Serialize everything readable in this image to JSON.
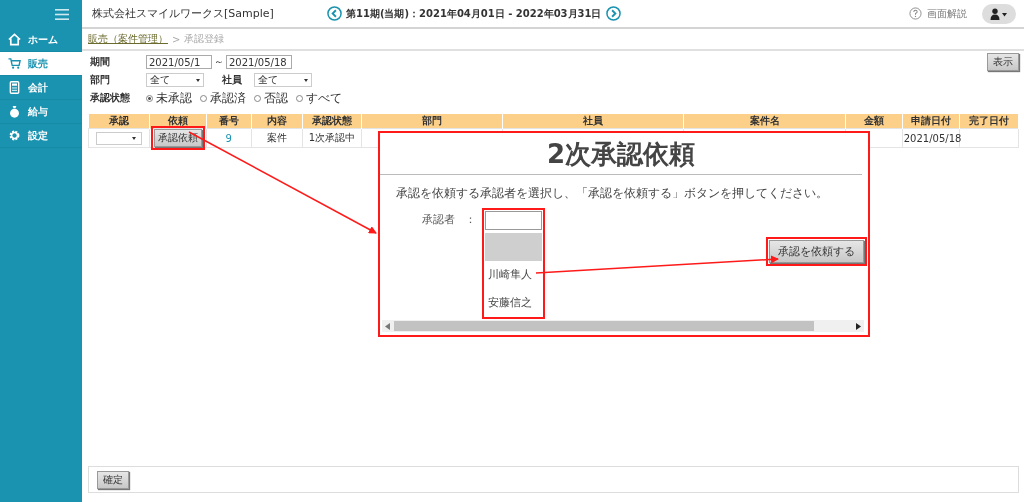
{
  "sidebar": {
    "items": [
      {
        "label": "ホーム",
        "selected": false
      },
      {
        "label": "販売",
        "selected": true
      },
      {
        "label": "会計",
        "selected": false
      },
      {
        "label": "給与",
        "selected": false
      },
      {
        "label": "設定",
        "selected": false
      }
    ]
  },
  "header": {
    "company": "株式会社スマイルワークス[Sample]",
    "period": "第11期(当期)：2021年04月01日 - 2022年03月31日",
    "help": "画面解説"
  },
  "breadcrumb": {
    "link": "販売（案件管理）",
    "separator": ">",
    "current": "承認登録"
  },
  "filters": {
    "period_label": "期間",
    "date_from": "2021/05/1",
    "tilde": "～",
    "date_to": "2021/05/18",
    "department_label": "部門",
    "department": "全て",
    "employee_label": "社員",
    "employee": "全て",
    "status_label": "承認状態",
    "status_options": [
      {
        "label": "未承認",
        "selected": true
      },
      {
        "label": "承認済",
        "selected": false
      },
      {
        "label": "否認",
        "selected": false
      },
      {
        "label": "すべて",
        "selected": false
      }
    ],
    "show_button": "表示"
  },
  "table": {
    "columns": [
      "承認",
      "依頼",
      "番号",
      "内容",
      "承認状態",
      "部門",
      "社員",
      "案件名",
      "金額",
      "申請日付",
      "完了日付"
    ],
    "rows": [
      {
        "request_button": "承認依頼",
        "number": "9",
        "content": "案件",
        "status": "1次承認中",
        "applied": "2021/05/18"
      }
    ]
  },
  "dialog": {
    "title": "2次承認依頼",
    "instruction": "承認を依頼する承認者を選択し、「承認を依頼する」ボタンを押してください。",
    "approver_label": "承認者",
    "colon": "：",
    "blank_highlighted": true,
    "options": [
      {
        "label": "川崎隼人",
        "selected": false
      },
      {
        "label": "安藤信之",
        "selected": false
      }
    ],
    "submit": "承認を依頼する"
  },
  "footer": {
    "confirm": "確定"
  }
}
